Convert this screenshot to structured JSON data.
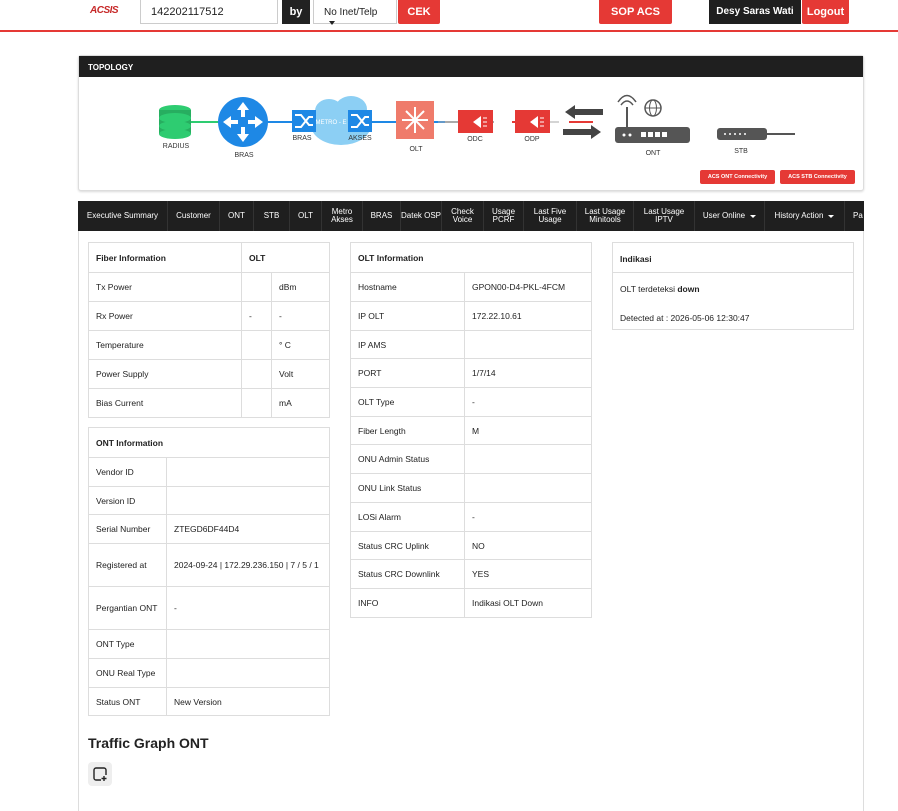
{
  "header": {
    "logo_text": "ACSIS",
    "search_value": "142202117512",
    "by_label": "by",
    "search_type": "No Inet/Telp",
    "cek_label": "CEK",
    "sop_label": "SOP ACS",
    "user_name": "Desy Saras Wati",
    "logout_label": "Logout"
  },
  "topology": {
    "title": "TOPOLOGY",
    "nodes": {
      "radius": "RADIUS",
      "bras": "BRAS",
      "bras2": "BRAS",
      "metro_cloud": "METRO - E",
      "akses": "AKSES",
      "olt": "OLT",
      "odc": "ODC",
      "odp": "ODP",
      "ont": "ONT",
      "stb": "STB"
    },
    "acs_ont_label": "ACS ONT Connectivity",
    "acs_stb_label": "ACS STB Connectivity"
  },
  "nav": {
    "items": [
      {
        "label": "Executive Summary"
      },
      {
        "label": "Customer"
      },
      {
        "label": "ONT"
      },
      {
        "label": "STB"
      },
      {
        "label": "OLT"
      },
      {
        "label": "Metro Akses"
      },
      {
        "label": "BRAS"
      },
      {
        "label": "Datek OSP"
      },
      {
        "label": "Check Voice"
      },
      {
        "label": "Usage PCRF"
      },
      {
        "label": "Last Five Usage"
      },
      {
        "label": "Last Usage Minitools"
      },
      {
        "label": "Last Usage IPTV"
      },
      {
        "label": "User Online"
      },
      {
        "label": "History Action"
      },
      {
        "label": "Pa S"
      }
    ]
  },
  "fiber": {
    "title": "Fiber Information",
    "olt_header": "OLT",
    "rows": [
      {
        "label": "Tx Power",
        "value": "",
        "unit": "dBm"
      },
      {
        "label": "Rx Power",
        "value": "-",
        "unit": "-"
      },
      {
        "label": "Temperature",
        "value": "",
        "unit": "° C"
      },
      {
        "label": "Power Supply",
        "value": "",
        "unit": "Volt"
      },
      {
        "label": "Bias Current",
        "value": "",
        "unit": "mA"
      }
    ]
  },
  "ont": {
    "title": "ONT Information",
    "rows": [
      {
        "label": "Vendor ID",
        "value": ""
      },
      {
        "label": "Version ID",
        "value": ""
      },
      {
        "label": "Serial Number",
        "value": "ZTEGD6DF44D4"
      },
      {
        "label": "Registered at",
        "value": "2024-09-24 | 172.29.236.150 | 7 / 5 / 1"
      },
      {
        "label": "Pergantian ONT",
        "value": "-"
      },
      {
        "label": "ONT Type",
        "value": ""
      },
      {
        "label": "ONU Real Type",
        "value": ""
      },
      {
        "label": "Status ONT",
        "value": "New Version"
      }
    ]
  },
  "olt": {
    "title": "OLT Information",
    "rows": [
      {
        "label": "Hostname",
        "value": "GPON00-D4-PKL-4FCM"
      },
      {
        "label": "IP OLT",
        "value": "172.22.10.61"
      },
      {
        "label": "IP AMS",
        "value": ""
      },
      {
        "label": "PORT",
        "value": "1/7/14"
      },
      {
        "label": "OLT Type",
        "value": "-"
      },
      {
        "label": "Fiber Length",
        "value": "M"
      },
      {
        "label": "ONU Admin Status",
        "value": ""
      },
      {
        "label": "ONU Link Status",
        "value": ""
      },
      {
        "label": "LOSi Alarm",
        "value": "-"
      },
      {
        "label": "Status CRC Uplink",
        "value": "NO"
      },
      {
        "label": "Status CRC Downlink",
        "value": "YES"
      },
      {
        "label": "INFO",
        "value": "Indikasi OLT Down"
      }
    ]
  },
  "indikasi": {
    "title": "Indikasi",
    "line1_prefix": "OLT terdeteksi ",
    "line1_bold": "down",
    "line2": "Detected at : 2026-05-06 12:30:47"
  },
  "traffic": {
    "title": "Traffic Graph ONT"
  },
  "colors": {
    "accent": "#e53935",
    "dark": "#1f1f1f",
    "radius_green": "#2ecc71",
    "bras_blue": "#1e88e5",
    "olt_salmon": "#ef7b6b"
  }
}
